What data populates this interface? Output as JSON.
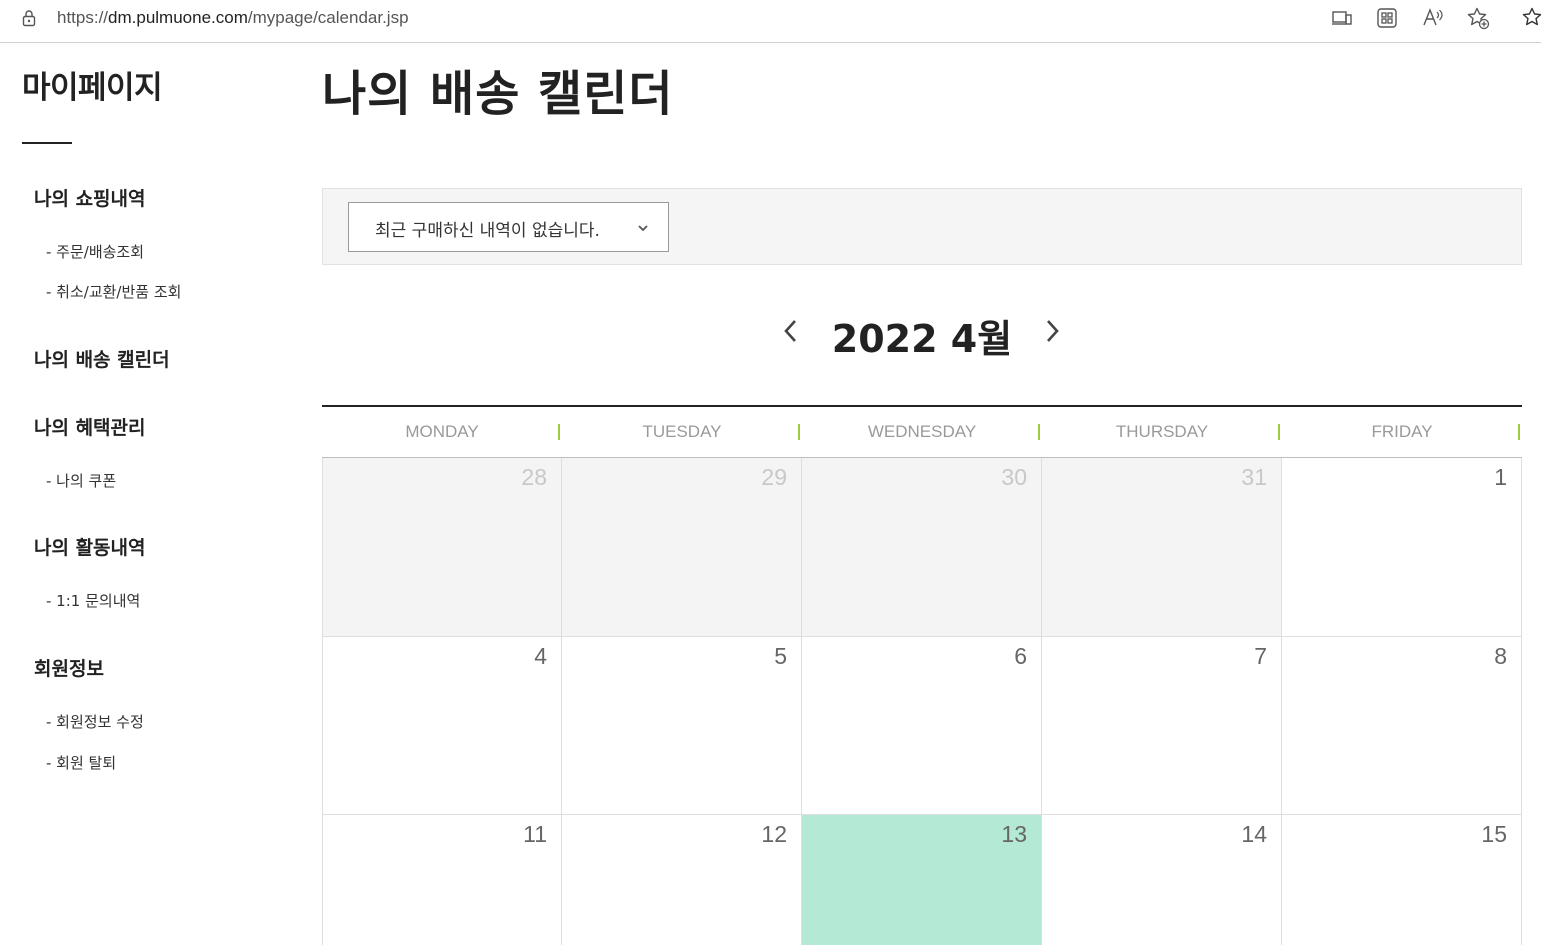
{
  "browser": {
    "url_prefix": "https://",
    "url_host": "dm.pulmuone.com",
    "url_path": "/mypage/calendar.jsp",
    "tools": [
      "device-icon",
      "apps-icon",
      "read-aloud-icon",
      "add-favorite-icon",
      "favorites-icon"
    ]
  },
  "sidebar": {
    "title": "마이페이지",
    "groups": [
      {
        "label": "나의 쇼핑내역",
        "items": [
          "- 주문/배송조회",
          "- 취소/교환/반품 조회"
        ]
      },
      {
        "label": "나의 배송 캘린더",
        "items": []
      },
      {
        "label": "나의 혜택관리",
        "items": [
          "- 나의 쿠폰"
        ]
      },
      {
        "label": "나의 활동내역",
        "items": [
          "- 1:1 문의내역"
        ]
      },
      {
        "label": "회원정보",
        "items": [
          "- 회원정보 수정",
          "- 회원 탈퇴"
        ]
      }
    ]
  },
  "main": {
    "title": "나의 배송 캘린더",
    "order_select": {
      "value": "최근 구매하신 내역이 없습니다."
    },
    "month_label": "2022 4월"
  },
  "calendar": {
    "weekdays": [
      "MONDAY",
      "TUESDAY",
      "WEDNESDAY",
      "THURSDAY",
      "FRIDAY"
    ],
    "weeks": [
      [
        {
          "d": "28",
          "other": true
        },
        {
          "d": "29",
          "other": true
        },
        {
          "d": "30",
          "other": true
        },
        {
          "d": "31",
          "other": true
        },
        {
          "d": "1"
        }
      ],
      [
        {
          "d": "4"
        },
        {
          "d": "5"
        },
        {
          "d": "6"
        },
        {
          "d": "7"
        },
        {
          "d": "8"
        }
      ],
      [
        {
          "d": "11"
        },
        {
          "d": "12"
        },
        {
          "d": "13",
          "today": true
        },
        {
          "d": "14"
        },
        {
          "d": "15"
        }
      ]
    ]
  },
  "colors": {
    "accent_tick": "#9ccc3b",
    "today_bg": "#b3e9d5"
  }
}
